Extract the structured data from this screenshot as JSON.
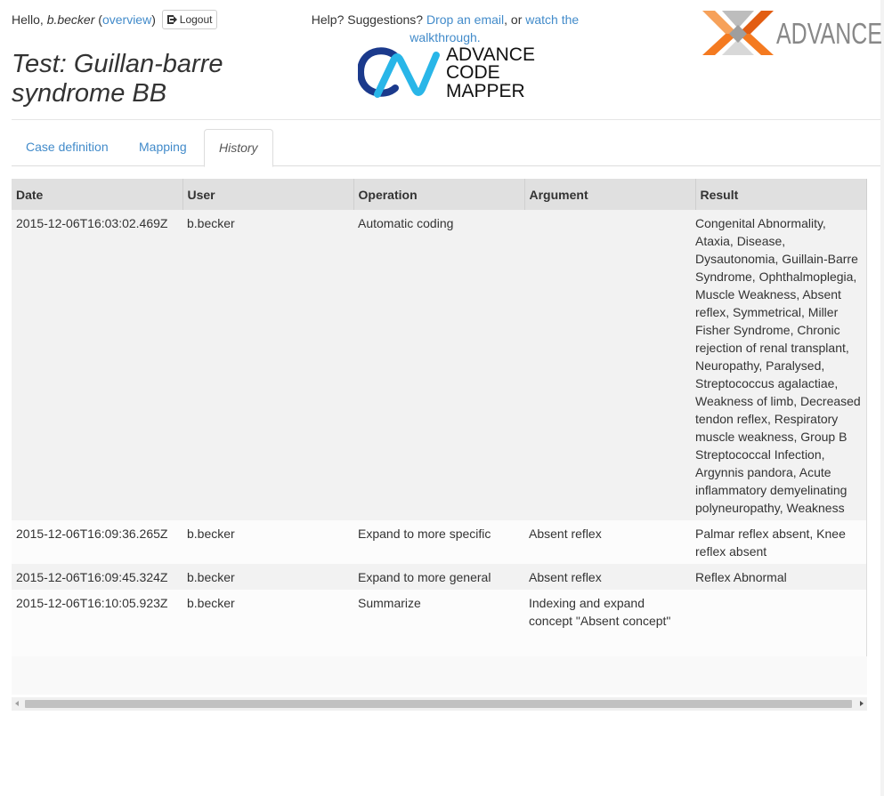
{
  "header": {
    "greeting_prefix": "Hello,",
    "username": "b.becker",
    "paren_open": "(",
    "overview_link": "overview",
    "paren_close": ")",
    "logout_label": "Logout",
    "help_text": "Help? Suggestions?",
    "email_link": "Drop an email",
    "or_text": ", or",
    "walkthrough_link": "watch the walkthrough."
  },
  "code_mapper_logo": {
    "monogram": "CM",
    "line1": "ADVANCE",
    "line2": "CODE",
    "line3": "MAPPER"
  },
  "advance_logo": {
    "wordmark": "ADVANCE"
  },
  "page": {
    "title": "Test: Guillan-barre syndrome BB"
  },
  "tabs": [
    {
      "label": "Case definition"
    },
    {
      "label": "Mapping"
    },
    {
      "label": "History"
    }
  ],
  "active_tab": "History",
  "history_table": {
    "columns": [
      "Date",
      "User",
      "Operation",
      "Argument",
      "Result"
    ],
    "rows": [
      {
        "date": "2015-12-06T16:03:02.469Z",
        "user": "b.becker",
        "operation": "Automatic coding",
        "argument": "",
        "result": "Congenital Abnormality, Ataxia, Disease, Dysautonomia, Guillain-Barre Syndrome, Ophthalmoplegia, Muscle Weakness, Absent reflex, Symmetrical, Miller Fisher Syndrome, Chronic rejection of renal transplant, Neuropathy, Paralysed, Streptococcus agalactiae, Weakness of limb, Decreased tendon reflex, Respiratory muscle weakness, Group B Streptococcal Infection, Argynnis pandora, Acute inflammatory demyelinating polyneuropathy, Weakness"
      },
      {
        "date": "2015-12-06T16:09:36.265Z",
        "user": "b.becker",
        "operation": "Expand to more specific",
        "argument": "Absent reflex",
        "result": "Palmar reflex absent, Knee reflex absent"
      },
      {
        "date": "2015-12-06T16:09:45.324Z",
        "user": "b.becker",
        "operation": "Expand to more general",
        "argument": "Absent reflex",
        "result": "Reflex Abnormal"
      },
      {
        "date": "2015-12-06T16:10:05.923Z",
        "user": "b.becker",
        "operation": "Summarize",
        "argument": "Indexing and expand concept \"Absent concept\"",
        "result": ""
      }
    ]
  },
  "colors": {
    "link": "#428bca",
    "cm_logo_dark": "#1b3a8c",
    "cm_logo_cyan": "#29b6e8",
    "advance_orange": "#f47a20",
    "advance_grey": "#888888"
  }
}
